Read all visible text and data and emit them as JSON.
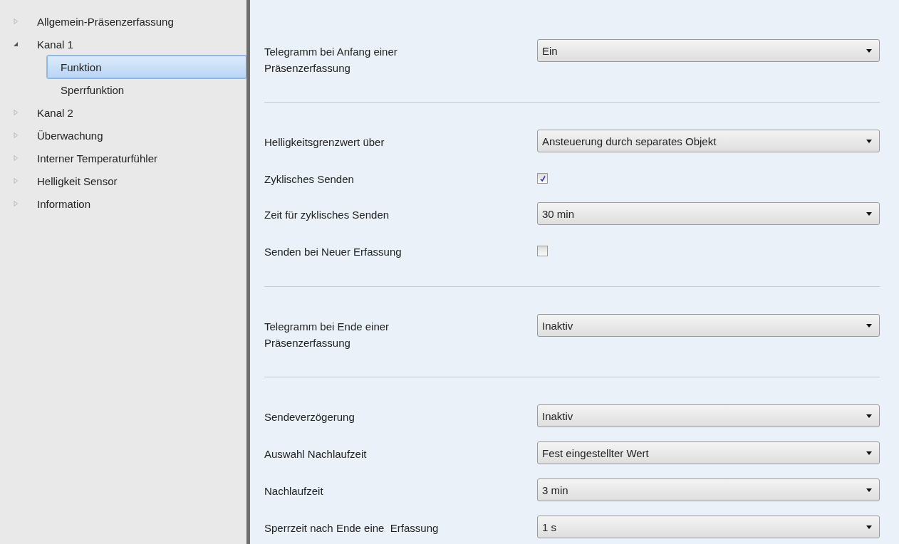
{
  "sidebar": {
    "items": [
      {
        "label": "Allgemein-Präsenzerfassung",
        "expanded": false,
        "selected": false
      },
      {
        "label": "Kanal 1",
        "expanded": true,
        "selected": false,
        "children": [
          {
            "label": "Funktion",
            "selected": true
          },
          {
            "label": "Sperrfunktion",
            "selected": false
          }
        ]
      },
      {
        "label": "Kanal 2",
        "expanded": false,
        "selected": false
      },
      {
        "label": "Überwachung",
        "expanded": false,
        "selected": false
      },
      {
        "label": "Interner Temperaturfühler",
        "expanded": false,
        "selected": false
      },
      {
        "label": "Helligkeit Sensor",
        "expanded": false,
        "selected": false
      },
      {
        "label": "Information",
        "expanded": false,
        "selected": false
      }
    ]
  },
  "sections": [
    {
      "rows": [
        {
          "kind": "dropdown",
          "label": "Telegramm bei Anfang einer\nPräsenzerfassung",
          "value": "Ein"
        }
      ]
    },
    {
      "rows": [
        {
          "kind": "dropdown",
          "label": "Helligkeitsgrenzwert über",
          "value": "Ansteuerung durch separates Objekt"
        },
        {
          "kind": "checkbox",
          "label": "Zyklisches Senden",
          "checked": true
        },
        {
          "kind": "dropdown",
          "label": "Zeit für zyklisches Senden",
          "value": "30 min"
        },
        {
          "kind": "checkbox",
          "label": "Senden bei Neuer Erfassung",
          "checked": false
        }
      ]
    },
    {
      "rows": [
        {
          "kind": "dropdown",
          "label": "Telegramm bei Ende einer\nPräsenzerfassung",
          "value": "Inaktiv"
        }
      ]
    },
    {
      "rows": [
        {
          "kind": "dropdown",
          "label": "Sendeverzögerung",
          "value": "Inaktiv"
        },
        {
          "kind": "dropdown",
          "label": "Auswahl Nachlaufzeit",
          "value": "Fest eingestellter Wert"
        },
        {
          "kind": "dropdown",
          "label": "Nachlaufzeit",
          "value": "3 min"
        },
        {
          "kind": "dropdown",
          "label": "Sperrzeit nach Ende eine  Erfassung",
          "value": "1 s"
        }
      ]
    }
  ]
}
